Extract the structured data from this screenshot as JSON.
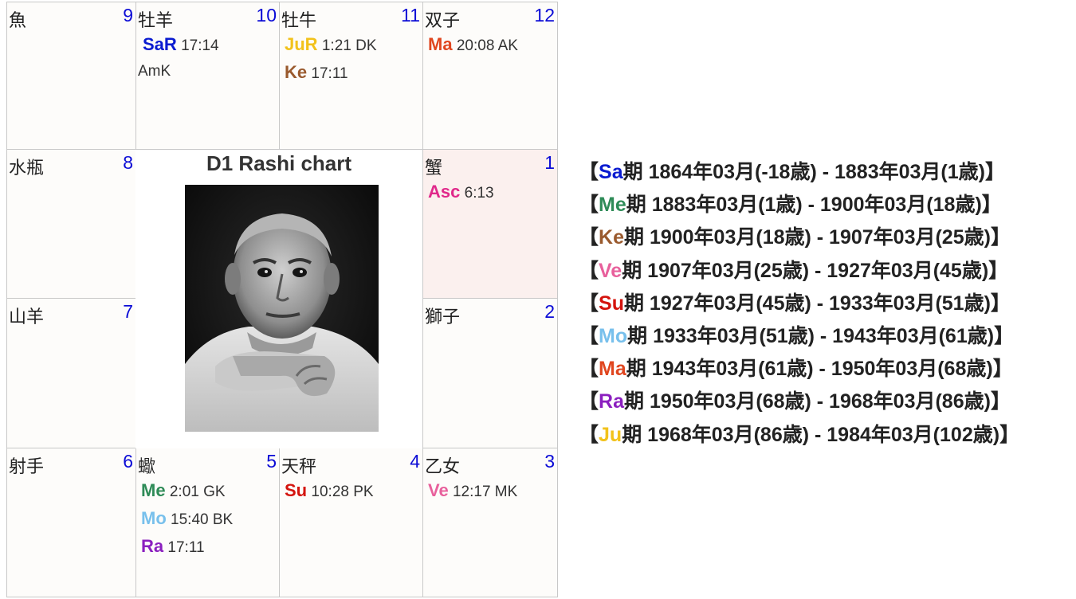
{
  "chart_title": "D1 Rashi chart",
  "houses": {
    "h9": {
      "sign": "魚",
      "num": "9"
    },
    "h10": {
      "sign": "牡羊",
      "num": "10",
      "planets": [
        {
          "name": "SaR",
          "color": "#0a1bd0",
          "text": "17:14"
        }
      ],
      "extra": "AmK"
    },
    "h11": {
      "sign": "牡牛",
      "num": "11",
      "planets": [
        {
          "name": "JuR",
          "color": "#f2c21b",
          "text": "1:21 DK"
        },
        {
          "name": "Ke",
          "color": "#9a5a2e",
          "text": "17:11"
        }
      ]
    },
    "h12": {
      "sign": "双子",
      "num": "12",
      "planets": [
        {
          "name": "Ma",
          "color": "#e0461f",
          "text": "20:08 AK"
        }
      ]
    },
    "h8": {
      "sign": "水瓶",
      "num": "8"
    },
    "h1": {
      "sign": "蟹",
      "num": "1",
      "planets": [
        {
          "name": "Asc",
          "color": "#e0288a",
          "text": "6:13"
        }
      ]
    },
    "h7": {
      "sign": "山羊",
      "num": "7"
    },
    "h2": {
      "sign": "獅子",
      "num": "2"
    },
    "h6": {
      "sign": "射手",
      "num": "6"
    },
    "h5": {
      "sign": "蠍",
      "num": "5",
      "planets": [
        {
          "name": "Me",
          "color": "#2e8b57",
          "text": "2:01 GK"
        },
        {
          "name": "Mo",
          "color": "#78c0ec",
          "text": "15:40 BK"
        },
        {
          "name": "Ra",
          "color": "#8b1fbf",
          "text": "17:11"
        }
      ]
    },
    "h4": {
      "sign": "天秤",
      "num": "4",
      "planets": [
        {
          "name": "Su",
          "color": "#d4140e",
          "text": "10:28 PK"
        }
      ]
    },
    "h3": {
      "sign": "乙女",
      "num": "3",
      "planets": [
        {
          "name": "Ve",
          "color": "#e8609c",
          "text": "12:17 MK"
        }
      ]
    }
  },
  "dasha": {
    "open": "【",
    "close": "】",
    "period_suffix": "期",
    "entries": [
      {
        "planet": "Sa",
        "color": "#0a1bd0",
        "range": " 1864年03月(-18歳) - 1883年03月(1歳)"
      },
      {
        "planet": "Me",
        "color": "#2e8b57",
        "range": " 1883年03月(1歳) - 1900年03月(18歳)"
      },
      {
        "planet": "Ke",
        "color": "#9a5a2e",
        "range": " 1900年03月(18歳) - 1907年03月(25歳)"
      },
      {
        "planet": "Ve",
        "color": "#e8609c",
        "range": " 1907年03月(25歳) - 1927年03月(45歳)"
      },
      {
        "planet": "Su",
        "color": "#d4140e",
        "range": " 1927年03月(45歳) - 1933年03月(51歳)"
      },
      {
        "planet": "Mo",
        "color": "#78c0ec",
        "range": " 1933年03月(51歳) - 1943年03月(61歳)"
      },
      {
        "planet": "Ma",
        "color": "#e0461f",
        "range": " 1943年03月(61歳) - 1950年03月(68歳)"
      },
      {
        "planet": "Ra",
        "color": "#8b1fbf",
        "range": " 1950年03月(68歳) - 1968年03月(86歳)"
      },
      {
        "planet": "Ju",
        "color": "#f2c21b",
        "range": " 1968年03月(86歳) - 1984年03月(102歳)"
      }
    ]
  }
}
